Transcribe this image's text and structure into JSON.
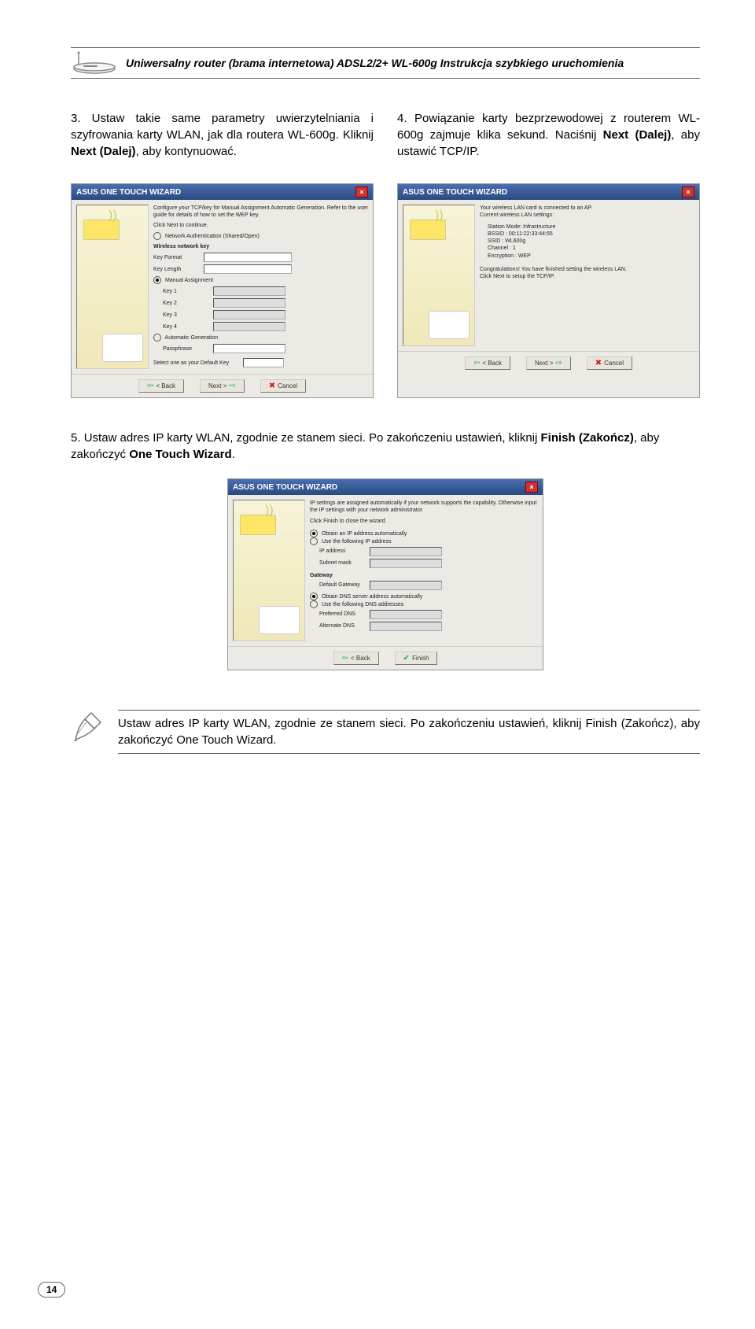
{
  "header": {
    "title": "Uniwersalny router (brama internetowa) ADSL2/2+ WL-600g Instrukcja szybkiego uruchomienia"
  },
  "step3": {
    "num": "3.",
    "text_a": "Ustaw takie same parametry uwierzytelniania i szyfrowania karty WLAN, jak dla routera WL-600g. Kliknij ",
    "bold_a": "Next (Dalej)",
    "text_b": ", aby kontynuować."
  },
  "step4": {
    "num": "4.",
    "text_a": "Powiązanie karty bezprzewodowej z routerem WL-600g zajmuje klika sekund. Naciśnij ",
    "bold_a": "Next (Dalej)",
    "text_b": ", aby ustawić TCP/IP."
  },
  "step5": {
    "num": "5.",
    "text_a": "Ustaw adres IP karty WLAN, zgodnie ze stanem sieci. Po zakończeniu ustawień, kliknij ",
    "bold_a": "Finish (Zakończ)",
    "text_b": ", aby zakończyć ",
    "bold_b": "One Touch Wizard",
    "text_c": "."
  },
  "note": {
    "text": "Ustaw adres IP karty WLAN, zgodnie ze stanem sieci. Po zakończeniu ustawień, kliknij Finish (Zakończ), aby zakończyć One Touch Wizard."
  },
  "page_number": "14",
  "wiz": {
    "title": "ASUS ONE TOUCH WIZARD",
    "btn_back": "< Back",
    "btn_next": "Next >",
    "btn_cancel": "Cancel",
    "btn_finish": "Finish"
  }
}
